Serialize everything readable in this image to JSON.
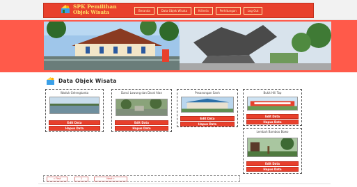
{
  "app": {
    "title_line1": "SPK Pemilihan",
    "title_line2": "Objek Wisata"
  },
  "nav": [
    {
      "label": "Beranda"
    },
    {
      "label": "Data Objek Wisata"
    },
    {
      "label": "Kriteria"
    },
    {
      "label": "Perhitungan"
    },
    {
      "label": "Log Out"
    }
  ],
  "section": {
    "title": "Data Objek Wisata"
  },
  "cards": [
    {
      "name": "Waduk Gelengkanta",
      "caption": "",
      "buttons": [
        "Edit Data",
        "Hapus Data"
      ]
    },
    {
      "name": "Danci Lowung dan Daral Alan",
      "caption": "",
      "buttons": [
        "Edit Data",
        "Hapus Data"
      ]
    },
    {
      "name": "Pesanongan Sanh",
      "caption": "",
      "buttons": [
        "Edit Data",
        "Hapus Data"
      ]
    },
    {
      "name": "Bukit Hili Top",
      "caption": "",
      "buttons": [
        "Edit Data",
        "Hapus Data"
      ]
    },
    {
      "name": "Lembah Bamboo Bowo",
      "caption": "",
      "buttons": [
        "Edit Data",
        "Hapus Data"
      ]
    }
  ],
  "pager": [
    "« First",
    "1",
    "Next »"
  ],
  "colors": {
    "brand_red": "#e8402c",
    "banner_bg": "#ff5a4a",
    "title_yellow": "#ffe066"
  }
}
